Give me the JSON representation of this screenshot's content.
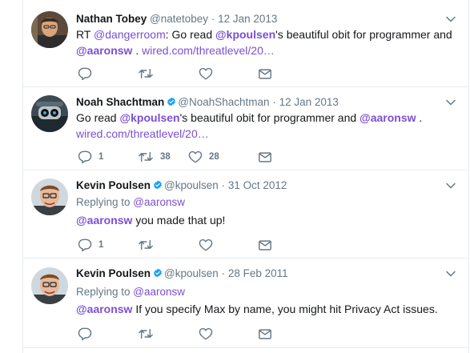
{
  "tweets": [
    {
      "name": "Nathan Tobey",
      "handle": "@natetobey",
      "dot": "·",
      "date": "12 Jan 2013",
      "parts": {
        "p1": "RT ",
        "m1": "@dangerroom",
        "p2": ": Go read ",
        "m2": "@kpoulsen",
        "p3": "'s beautiful obit for programmer and",
        "m3": "@aaronsw",
        "p4": " . ",
        "link": "wired.com/threatlevel/20…"
      },
      "counts": {
        "reply": "",
        "retweet": "",
        "like": ""
      }
    },
    {
      "name": "Noah Shachtman",
      "handle": "@NoahShachtman",
      "dot": "·",
      "date": "12 Jan 2013",
      "parts": {
        "p1": "Go read ",
        "m1": "@kpoulsen",
        "p2": "'s beautiful obit for programmer and ",
        "m2": "@aaronsw",
        "p3": " .",
        "link": "wired.com/threatlevel/20…"
      },
      "counts": {
        "reply": "1",
        "retweet": "38",
        "like": "28"
      }
    },
    {
      "name": "Kevin Poulsen",
      "handle": "@kpoulsen",
      "dot": "·",
      "date": "31 Oct 2012",
      "replying_label": "Replying to ",
      "replying_to": "@aaronsw",
      "parts": {
        "m1": "@aaronsw",
        "p1": " you made that up!"
      },
      "counts": {
        "reply": "1",
        "retweet": "",
        "like": ""
      }
    },
    {
      "name": "Kevin Poulsen",
      "handle": "@kpoulsen",
      "dot": "·",
      "date": "28 Feb 2011",
      "replying_label": "Replying to ",
      "replying_to": "@aaronsw",
      "parts": {
        "m1": "@aaronsw",
        "p1": " If you specify Max by name, you might hit Privacy Act issues."
      },
      "counts": {
        "reply": "",
        "retweet": "",
        "like": ""
      }
    }
  ],
  "icons": {
    "reply": "reply-icon",
    "retweet": "retweet-icon",
    "like": "heart-icon",
    "dm": "envelope-icon",
    "verified": "verified-badge-icon",
    "more": "chevron-down-icon"
  },
  "colors": {
    "link": "#7a4fd4",
    "verified": "#1da1f2",
    "muted": "#657786"
  }
}
